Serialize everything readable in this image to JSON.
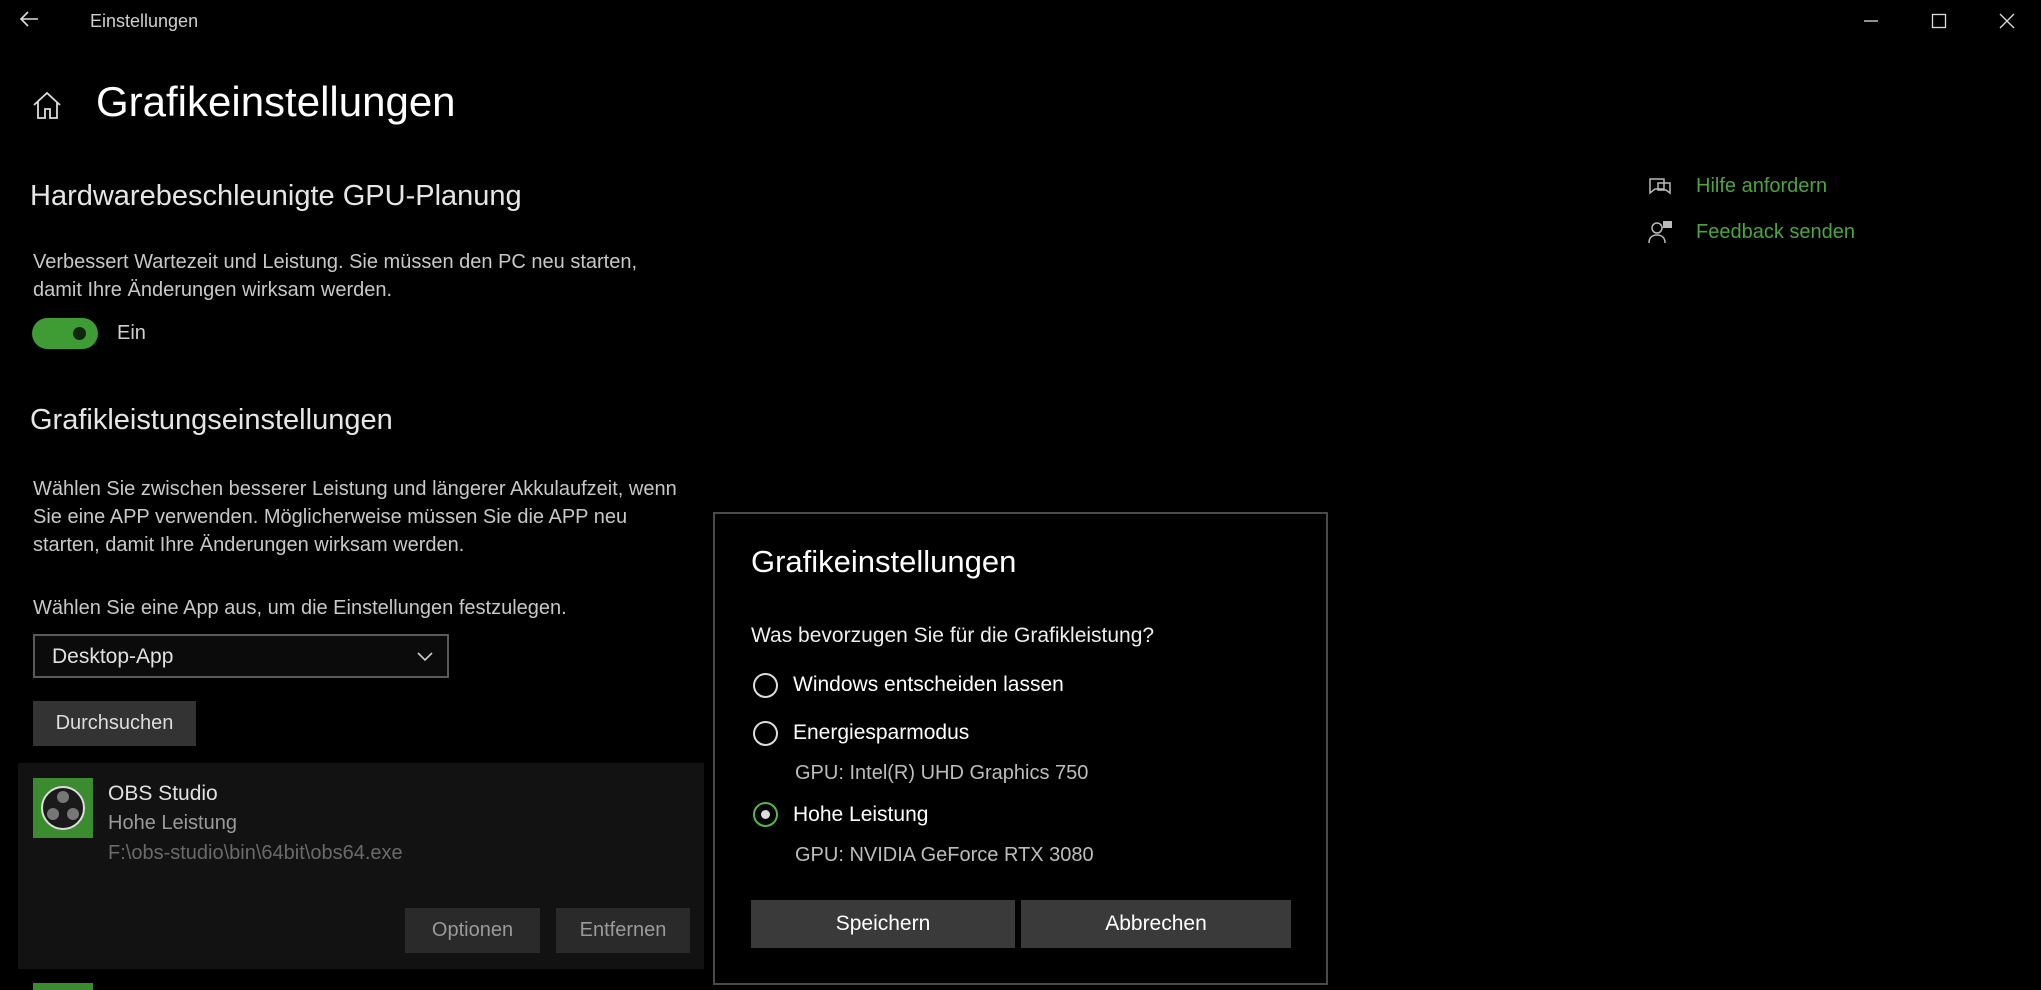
{
  "window": {
    "title": "Einstellungen",
    "controls": [
      "minimize-icon",
      "maximize-icon",
      "close-icon"
    ]
  },
  "page": {
    "title": "Grafikeinstellungen"
  },
  "gpu_scheduling": {
    "heading": "Hardwarebeschleunigte GPU-Planung",
    "description_line1": "Verbessert Wartezeit und Leistung. Sie müssen den PC neu starten,",
    "description_line2": "damit Ihre Änderungen wirksam werden.",
    "toggle_state": "Ein",
    "accent": "#3f9c35"
  },
  "graphics_performance": {
    "heading": "Grafikleistungseinstellungen",
    "description_line1": "Wählen Sie zwischen besserer Leistung und längerer Akkulaufzeit, wenn",
    "description_line2": "Sie eine APP verwenden. Möglicherweise müssen Sie die APP neu",
    "description_line3": "starten, damit Ihre Änderungen wirksam werden.",
    "select_prompt": "Wählen Sie eine App aus, um die Einstellungen festzulegen.",
    "select_value": "Desktop-App",
    "browse_label": "Durchsuchen"
  },
  "app_entry": {
    "name": "OBS Studio",
    "preference": "Hohe Leistung",
    "path": "F:\\obs-studio\\bin\\64bit\\obs64.exe",
    "options_label": "Optionen",
    "remove_label": "Entfernen"
  },
  "side_links": {
    "help": "Hilfe anfordern",
    "feedback": "Feedback senden",
    "link_color": "#4ca53f"
  },
  "dialog": {
    "title": "Grafikeinstellungen",
    "question": "Was bevorzugen Sie für die Grafikleistung?",
    "options": [
      {
        "label": "Windows entscheiden lassen",
        "sub": "",
        "selected": false
      },
      {
        "label": "Energiesparmodus",
        "sub": "GPU: Intel(R) UHD Graphics 750",
        "selected": false
      },
      {
        "label": "Hohe Leistung",
        "sub": "GPU: NVIDIA GeForce RTX 3080",
        "selected": true
      }
    ],
    "save_label": "Speichern",
    "cancel_label": "Abbrechen"
  }
}
